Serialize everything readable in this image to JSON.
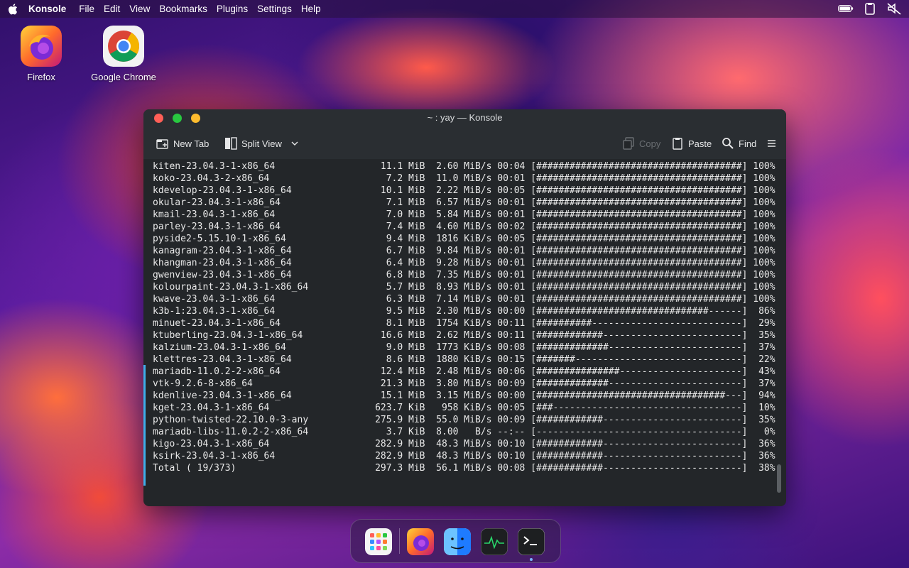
{
  "menubar": {
    "app_name": "Konsole",
    "items": [
      "File",
      "Edit",
      "View",
      "Bookmarks",
      "Plugins",
      "Settings",
      "Help"
    ]
  },
  "desktop_icons": [
    {
      "label": "Firefox",
      "icon": "firefox-icon"
    },
    {
      "label": "Google Chrome",
      "icon": "chrome-icon"
    }
  ],
  "window": {
    "title": "~ : yay — Konsole",
    "toolbar": {
      "new_tab": "New Tab",
      "split_view": "Split View",
      "copy": "Copy",
      "paste": "Paste",
      "find": "Find"
    }
  },
  "terminal": {
    "lines": [
      "kiten-23.04.3-1-x86_64                   11.1 MiB  2.60 MiB/s 00:04 [#####################################] 100%",
      "koko-23.04.3-2-x86_64                     7.2 MiB  11.0 MiB/s 00:01 [#####################################] 100%",
      "kdevelop-23.04.3-1-x86_64                10.1 MiB  2.22 MiB/s 00:05 [#####################################] 100%",
      "okular-23.04.3-1-x86_64                   7.1 MiB  6.57 MiB/s 00:01 [#####################################] 100%",
      "kmail-23.04.3-1-x86_64                    7.0 MiB  5.84 MiB/s 00:01 [#####################################] 100%",
      "parley-23.04.3-1-x86_64                   7.4 MiB  4.60 MiB/s 00:02 [#####################################] 100%",
      "pyside2-5.15.10-1-x86_64                  9.4 MiB  1816 KiB/s 00:05 [#####################################] 100%",
      "kanagram-23.04.3-1-x86_64                 6.7 MiB  9.84 MiB/s 00:01 [#####################################] 100%",
      "khangman-23.04.3-1-x86_64                 6.4 MiB  9.28 MiB/s 00:01 [#####################################] 100%",
      "gwenview-23.04.3-1-x86_64                 6.8 MiB  7.35 MiB/s 00:01 [#####################################] 100%",
      "kolourpaint-23.04.3-1-x86_64              5.7 MiB  8.93 MiB/s 00:01 [#####################################] 100%",
      "kwave-23.04.3-1-x86_64                    6.3 MiB  7.14 MiB/s 00:01 [#####################################] 100%",
      "k3b-1:23.04.3-1-x86_64                    9.5 MiB  2.30 MiB/s 00:00 [###############################------]  86%",
      "minuet-23.04.3-1-x86_64                   8.1 MiB  1754 KiB/s 00:11 [##########---------------------------]  29%",
      "ktuberling-23.04.3-1-x86_64              16.6 MiB  2.62 MiB/s 00:11 [############-------------------------]  35%",
      "kalzium-23.04.3-1-x86_64                  9.0 MiB  1773 KiB/s 00:08 [#############------------------------]  37%",
      "klettres-23.04.3-1-x86_64                 8.6 MiB  1880 KiB/s 00:15 [#######------------------------------]  22%",
      "mariadb-11.0.2-2-x86_64                  12.4 MiB  2.48 MiB/s 00:06 [###############----------------------]  43%",
      "vtk-9.2.6-8-x86_64                       21.3 MiB  3.80 MiB/s 00:09 [#############------------------------]  37%",
      "kdenlive-23.04.3-1-x86_64                15.1 MiB  3.15 MiB/s 00:00 [##################################---]  94%",
      "kget-23.04.3-1-x86_64                   623.7 KiB   958 KiB/s 00:05 [###----------------------------------]  10%",
      "python-twisted-22.10.0-3-any            275.9 MiB  55.0 MiB/s 00:09 [############-------------------------]  35%",
      "mariadb-libs-11.0.2-2-x86_64              3.7 KiB  8.00   B/s --:-- [-------------------------------------]   0%",
      "kigo-23.04.3-1-x86_64                   282.9 MiB  48.3 MiB/s 00:10 [############-------------------------]  36%",
      "ksirk-23.04.3-1-x86_64                  282.9 MiB  48.3 MiB/s 00:10 [############-------------------------]  36%",
      "Total ( 19/373)                         297.3 MiB  56.1 MiB/s 00:08 [############-------------------------]  38%"
    ]
  },
  "dock": {
    "items": [
      "launchpad-icon",
      "firefox-icon",
      "finder-icon",
      "activity-monitor-icon",
      "terminal-icon"
    ]
  }
}
